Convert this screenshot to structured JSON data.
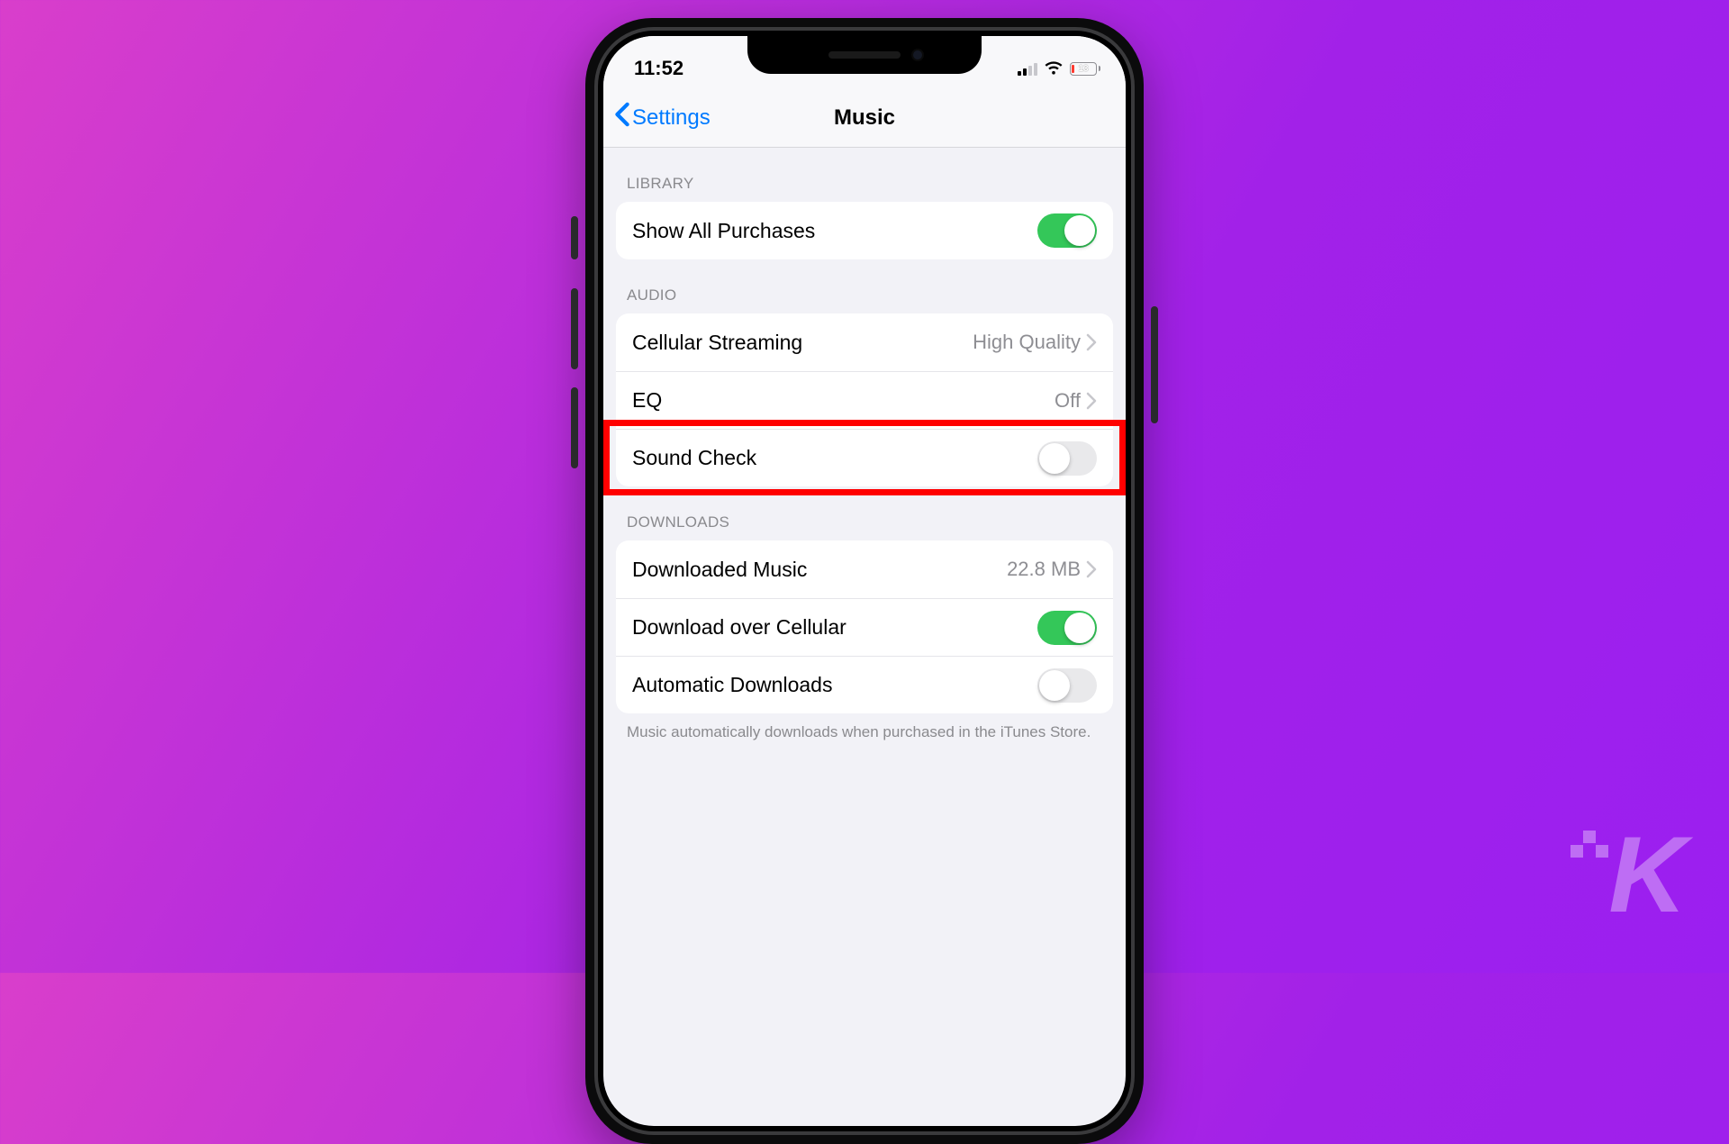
{
  "statusbar": {
    "time": "11:52",
    "battery_percent": "13",
    "battery_fill_pct": 13,
    "cellular_bars": 2,
    "wifi": true
  },
  "navbar": {
    "back_label": "Settings",
    "title": "Music"
  },
  "sections": {
    "library": {
      "header": "LIBRARY",
      "show_all_purchases": {
        "label": "Show All Purchases",
        "on": true
      }
    },
    "audio": {
      "header": "AUDIO",
      "cellular_streaming": {
        "label": "Cellular Streaming",
        "value": "High Quality"
      },
      "eq": {
        "label": "EQ",
        "value": "Off"
      },
      "sound_check": {
        "label": "Sound Check",
        "on": false
      }
    },
    "downloads": {
      "header": "DOWNLOADS",
      "downloaded_music": {
        "label": "Downloaded Music",
        "value": "22.8 MB"
      },
      "download_over_cellular": {
        "label": "Download over Cellular",
        "on": true
      },
      "automatic_downloads": {
        "label": "Automatic Downloads",
        "on": false
      },
      "footer": "Music automatically downloads when purchased in the iTunes Store."
    }
  },
  "highlight_target": "sound-check-row",
  "watermark": "K"
}
